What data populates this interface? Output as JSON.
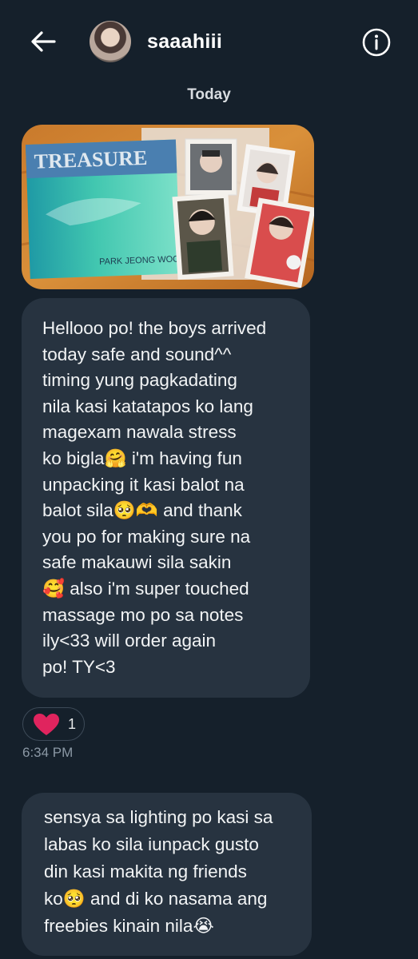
{
  "header": {
    "username": "saaahiii",
    "back_icon": "arrow-left-icon",
    "info_icon": "info-circle-icon"
  },
  "conversation": {
    "date_divider": "Today",
    "photo": {
      "album_title": "TREASURE",
      "member_name": "PARK JEONG WOO"
    },
    "messages": [
      {
        "text": "Hellooo po! the boys arrived\ntoday safe and sound^^\ntiming yung pagkadating\nnila kasi katatapos ko lang\nmagexam nawala stress\nko bigla🤗 i'm having fun\nunpacking it kasi balot na\nbalot sila🥺🫶 and thank\nyou po for making sure na\nsafe makauwi sila sakin\n🥰 also i'm super touched\nmassage mo po sa notes\nily<33 will order again\npo! TY<3",
        "reaction_icon": "heart-icon",
        "reaction_count": "1",
        "time": "6:34 PM"
      },
      {
        "text": "sensya sa lighting po kasi sa\nlabas ko sila iunpack gusto\ndin kasi makita ng friends\nko🥺 and di ko nasama ang\nfreebies kinain nila😭"
      }
    ]
  },
  "colors": {
    "background": "#15202b",
    "bubble": "#273340",
    "reaction_heart": "#f91880",
    "muted_text": "#8b98a5"
  }
}
